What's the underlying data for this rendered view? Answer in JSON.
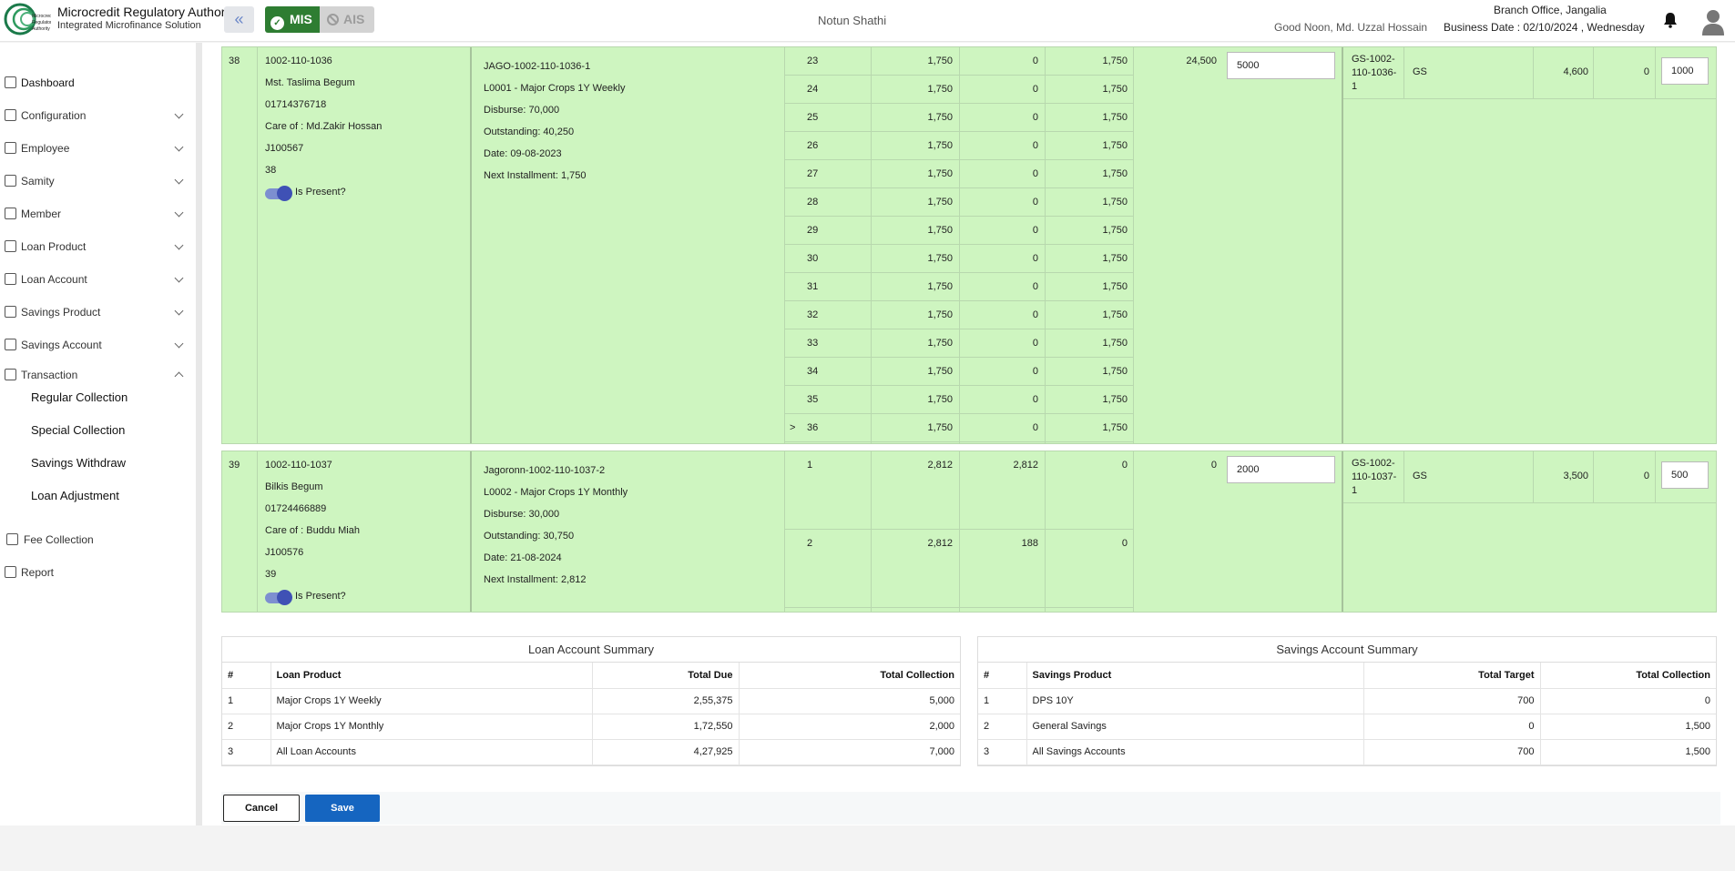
{
  "header": {
    "org_title": "Microcredit Regulatory Authority",
    "org_subtitle": "Integrated Microfinance Solution",
    "logo_text": "Microcredit Regulatory Authority",
    "mis_label": "MIS",
    "ais_label": "AIS",
    "center_title": "Notun Shathi",
    "greeting": "Good Noon, Md. Uzzal Hossain",
    "branch": "Branch Office, Jangalia",
    "business_date": "Business Date : 02/10/2024 , Wednesday"
  },
  "sidebar": {
    "items": [
      {
        "label": "Dashboard"
      },
      {
        "label": "Configuration"
      },
      {
        "label": "Employee"
      },
      {
        "label": "Samity"
      },
      {
        "label": "Member"
      },
      {
        "label": "Loan Product"
      },
      {
        "label": "Loan Account"
      },
      {
        "label": "Savings Product"
      },
      {
        "label": "Savings Account"
      },
      {
        "label": "Transaction"
      },
      {
        "label": "Fee Collection"
      },
      {
        "label": "Report"
      }
    ],
    "sub_items": [
      {
        "label": "Regular Collection"
      },
      {
        "label": "Special Collection"
      },
      {
        "label": "Savings Withdraw"
      },
      {
        "label": "Loan Adjustment"
      }
    ]
  },
  "members": [
    {
      "serial": "38",
      "code": "1002-110-1036",
      "name": "Mst. Taslima Begum",
      "phone": "01714376718",
      "care_of": "Care of : Md.Zakir Hossan",
      "jcode": "J100567",
      "number": "38",
      "present_label": "Is Present?",
      "loan": {
        "account": "JAGO-1002-110-1036-1",
        "product": "L0001 - Major Crops 1Y Weekly",
        "disburse": "Disburse: 70,000",
        "outstanding": "Outstanding: 40,250",
        "date": "Date: 09-08-2023",
        "next": "Next Installment: 1,750"
      },
      "installments": [
        {
          "marker": "",
          "no": "23",
          "amt": "1,750",
          "paid": "0",
          "due": "1,750"
        },
        {
          "marker": "",
          "no": "24",
          "amt": "1,750",
          "paid": "0",
          "due": "1,750"
        },
        {
          "marker": "",
          "no": "25",
          "amt": "1,750",
          "paid": "0",
          "due": "1,750"
        },
        {
          "marker": "",
          "no": "26",
          "amt": "1,750",
          "paid": "0",
          "due": "1,750"
        },
        {
          "marker": "",
          "no": "27",
          "amt": "1,750",
          "paid": "0",
          "due": "1,750"
        },
        {
          "marker": "",
          "no": "28",
          "amt": "1,750",
          "paid": "0",
          "due": "1,750"
        },
        {
          "marker": "",
          "no": "29",
          "amt": "1,750",
          "paid": "0",
          "due": "1,750"
        },
        {
          "marker": "",
          "no": "30",
          "amt": "1,750",
          "paid": "0",
          "due": "1,750"
        },
        {
          "marker": "",
          "no": "31",
          "amt": "1,750",
          "paid": "0",
          "due": "1,750"
        },
        {
          "marker": "",
          "no": "32",
          "amt": "1,750",
          "paid": "0",
          "due": "1,750"
        },
        {
          "marker": "",
          "no": "33",
          "amt": "1,750",
          "paid": "0",
          "due": "1,750"
        },
        {
          "marker": "",
          "no": "34",
          "amt": "1,750",
          "paid": "0",
          "due": "1,750"
        },
        {
          "marker": "",
          "no": "35",
          "amt": "1,750",
          "paid": "0",
          "due": "1,750"
        },
        {
          "marker": ">",
          "no": "36",
          "amt": "1,750",
          "paid": "0",
          "due": "1,750"
        }
      ],
      "total_due": "24,500",
      "collection": "5000",
      "savings": {
        "account": [
          "GS-1002-",
          "110-1036-",
          "1"
        ],
        "type": "GS",
        "balance": "4,600",
        "target": "0",
        "deposit": "1000"
      }
    },
    {
      "serial": "39",
      "code": "1002-110-1037",
      "name": "Bilkis Begum",
      "phone": "01724466889",
      "care_of": "Care of : Buddu Miah",
      "jcode": "J100576",
      "number": "39",
      "present_label": "Is Present?",
      "loan": {
        "account": "Jagoronn-1002-110-1037-2",
        "product": "L0002 - Major Crops 1Y Monthly",
        "disburse": "Disburse: 30,000",
        "outstanding": "Outstanding: 30,750",
        "date": "Date: 21-08-2024",
        "next": "Next Installment: 2,812"
      },
      "installments": [
        {
          "marker": "",
          "no": "1",
          "amt": "2,812",
          "paid": "2,812",
          "due": "0"
        },
        {
          "marker": "",
          "no": "2",
          "amt": "2,812",
          "paid": "188",
          "due": "0"
        }
      ],
      "total_due": "0",
      "collection": "2000",
      "savings": {
        "account": [
          "GS-1002-",
          "110-1037-",
          "1"
        ],
        "type": "GS",
        "balance": "3,500",
        "target": "0",
        "deposit": "500"
      }
    }
  ],
  "loan_summary": {
    "title": "Loan Account Summary",
    "headers": [
      "#",
      "Loan Product",
      "Total Due",
      "Total Collection"
    ],
    "rows": [
      [
        "1",
        "Major Crops 1Y Weekly",
        "2,55,375",
        "5,000"
      ],
      [
        "2",
        "Major Crops 1Y Monthly",
        "1,72,550",
        "2,000"
      ],
      [
        "3",
        "All Loan Accounts",
        "4,27,925",
        "7,000"
      ]
    ]
  },
  "savings_summary": {
    "title": "Savings Account Summary",
    "headers": [
      "#",
      "Savings Product",
      "Total Target",
      "Total Collection"
    ],
    "rows": [
      [
        "1",
        "DPS 10Y",
        "700",
        "0"
      ],
      [
        "2",
        "General Savings",
        "0",
        "1,500"
      ],
      [
        "3",
        "All Savings Accounts",
        "700",
        "1,500"
      ]
    ]
  },
  "actions": {
    "cancel": "Cancel",
    "save": "Save"
  },
  "colors": {
    "row_bg": "#cef5c0",
    "mis_green": "#2e7d32",
    "save_blue": "#1565c0",
    "toggle": "#3f51b5"
  },
  "icons": [
    "angles-left-icon",
    "check-circle-icon",
    "ban-icon",
    "bell-icon",
    "user-avatar-icon"
  ]
}
